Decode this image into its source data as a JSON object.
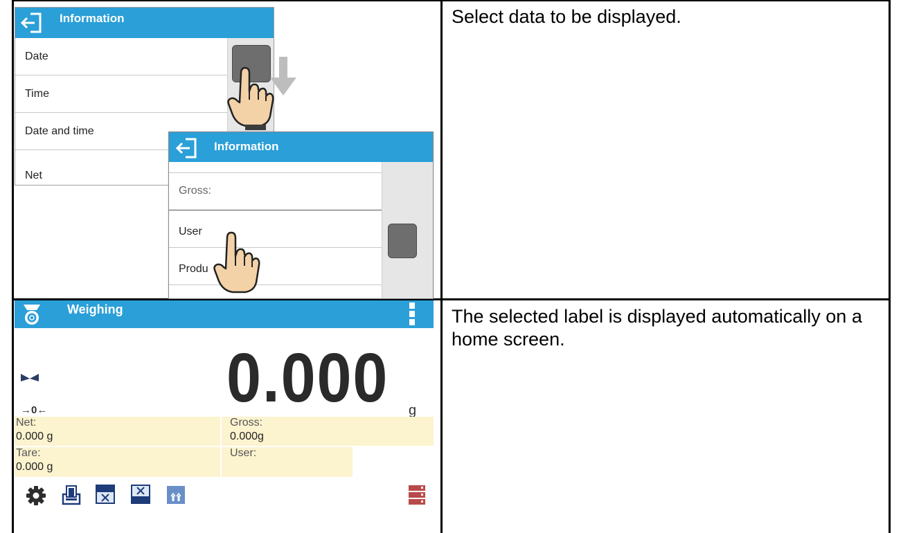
{
  "screen1": {
    "title": "Information",
    "items": [
      "Date",
      "Time",
      "Date and time",
      "Net"
    ]
  },
  "screen2": {
    "title": "Information",
    "items": [
      "Gross:",
      "User",
      "Produ"
    ]
  },
  "step1": {
    "description": "Select data to be displayed."
  },
  "weighing": {
    "title": "Weighing",
    "value": "0.000",
    "unit": "g",
    "zero_indicator": "→0←",
    "labels": [
      {
        "name": "Net:",
        "value": "0.000 g"
      },
      {
        "name": "Gross:",
        "value": "0.000g"
      },
      {
        "name": "Tare:",
        "value": "0.000 g"
      },
      {
        "name": "User:",
        "value": ""
      }
    ],
    "toolbar": [
      "gear-icon",
      "tare-icon",
      "formula-icon",
      "formula-alt-icon",
      "bar-chart-icon",
      "database-icon"
    ]
  },
  "step2": {
    "description": "The selected label is displayed automatically on a home screen."
  },
  "colors": {
    "header": "#2a9fd8",
    "label_bg": "#fcf3cf",
    "thumb": "#6e6e6e"
  }
}
